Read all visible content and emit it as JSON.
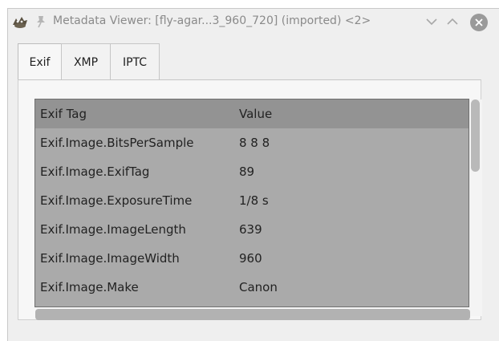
{
  "window": {
    "title": "Metadata Viewer: [fly-agar...3_960_720] (imported) <2>",
    "icons": [
      "gimp-icon",
      "pin-icon",
      "chevron-down-icon",
      "chevron-up-icon",
      "close-icon"
    ]
  },
  "tabs": [
    {
      "label": "Exif",
      "active": true
    },
    {
      "label": "XMP",
      "active": false
    },
    {
      "label": "IPTC",
      "active": false
    }
  ],
  "table": {
    "headers": {
      "tag": "Exif Tag",
      "value": "Value"
    },
    "rows": [
      {
        "tag": "Exif.Image.BitsPerSample",
        "value": "8 8 8"
      },
      {
        "tag": "Exif.Image.ExifTag",
        "value": "89"
      },
      {
        "tag": "Exif.Image.ExposureTime",
        "value": "1/8 s"
      },
      {
        "tag": "Exif.Image.ImageLength",
        "value": "639"
      },
      {
        "tag": "Exif.Image.ImageWidth",
        "value": "960"
      },
      {
        "tag": "Exif.Image.Make",
        "value": "Canon"
      }
    ]
  },
  "colors": {
    "title_text": "#8a8a8a",
    "table_background": "#aaaaaa",
    "table_header": "#939393",
    "window_background": "#efefef"
  }
}
